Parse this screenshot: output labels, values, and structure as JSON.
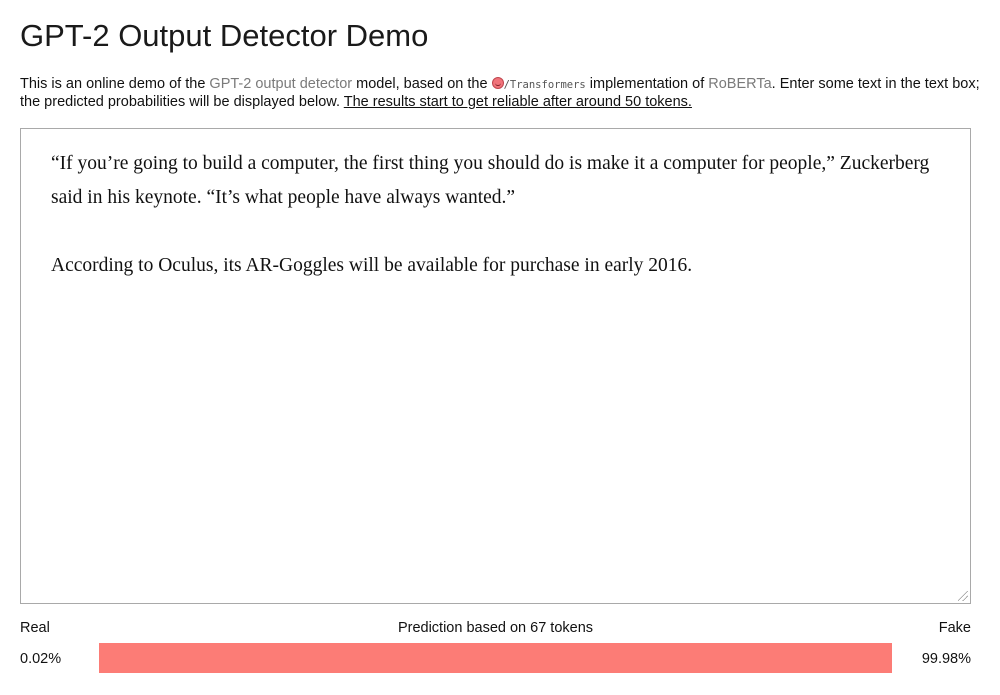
{
  "page": {
    "title": "GPT-2 Output Detector Demo"
  },
  "intro": {
    "text_1": "This is an online demo of the ",
    "link_detector": "GPT-2 output detector",
    "text_2": " model, based on the ",
    "hf_icon": "hugging-face-emoji",
    "transformers_label": "/Transformers",
    "text_3": " implementation of ",
    "link_roberta": "RoBERTa",
    "text_4": ". Enter some text in the text box; the predicted probabilities will be displayed below. ",
    "reliability_note": "The results start to get reliable after around 50 tokens."
  },
  "textbox": {
    "paragraphs": [
      "“If you’re going to build a computer, the first thing you should do is make it a computer for people,” Zuckerberg said in his keynote. “It’s what people have always wanted.”",
      "According to Oculus, its AR-Goggles will be available for purchase in early 2016."
    ]
  },
  "result": {
    "real_label": "Real",
    "fake_label": "Fake",
    "prediction_text": "Prediction based on 67 tokens",
    "real_percent": "0.02%",
    "fake_percent": "99.98%",
    "real_fraction": 0.0002,
    "fake_fraction": 0.9998
  },
  "colors": {
    "fake_bar": "#fc7c76",
    "real_bar": "#8fb3e6",
    "link": "#7a7a7a"
  }
}
